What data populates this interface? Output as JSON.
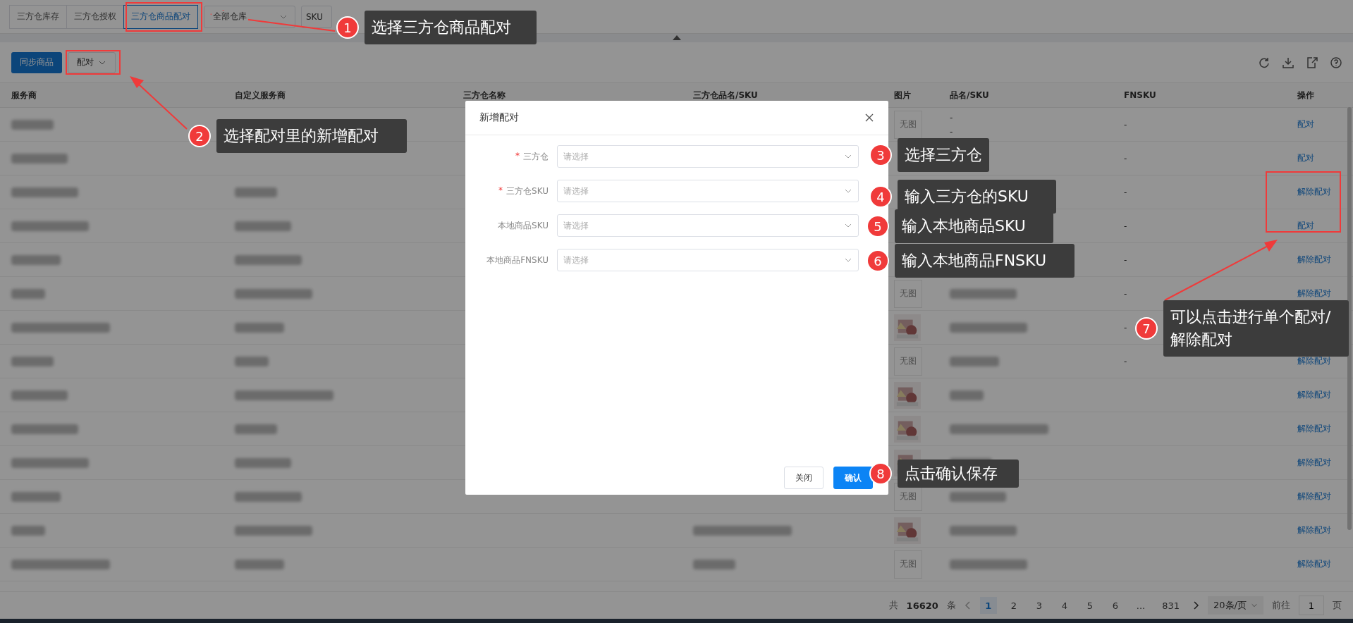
{
  "top_tabs": [
    {
      "label": "三方仓库存",
      "selected": false
    },
    {
      "label": "三方仓授权",
      "selected": false
    },
    {
      "label": "三方仓商品配对",
      "selected": true
    }
  ],
  "filters": {
    "warehouse_select": {
      "value": "全部仓库"
    },
    "search_type": {
      "value": "SKU"
    }
  },
  "toolbar": {
    "buttons": [
      {
        "label": "同步商品",
        "kind": "primary"
      },
      {
        "label": "配对",
        "kind": "dropdown"
      }
    ]
  },
  "table": {
    "columns": [
      "服务商",
      "自定义服务商",
      "三方仓名称",
      "三方仓品名/SKU",
      "图片",
      "品名/SKU",
      "FNSKU",
      "操作"
    ],
    "rows": [
      {
        "image": {
          "kind": "placeholder",
          "text": "无图"
        },
        "product_lines": [
          "-",
          "-"
        ],
        "fnsku": "-",
        "action": "配对"
      },
      {
        "fnsku": "-",
        "action": "配对"
      },
      {
        "fnsku": "-",
        "action": "解除配对"
      },
      {
        "fnsku": "-",
        "action": "配对"
      },
      {
        "fnsku": "-",
        "action": "解除配对"
      },
      {
        "image": {
          "kind": "placeholder",
          "text": "无图"
        },
        "fnsku": "-",
        "action": "解除配对"
      },
      {
        "fnsku": "-"
      },
      {
        "image": {
          "kind": "placeholder",
          "text": "无图"
        },
        "fnsku": "-",
        "action": "解除配对"
      },
      {
        "action": "解除配对"
      },
      {
        "action": "解除配对"
      },
      {
        "action": "解除配对"
      },
      {
        "image": {
          "kind": "placeholder",
          "text": "无图"
        },
        "action": "解除配对"
      },
      {
        "action": "解除配对"
      },
      {
        "image": {
          "kind": "placeholder",
          "text": "无图"
        },
        "action": "解除配对"
      }
    ]
  },
  "pagination": {
    "total_prefix": "共",
    "total": "16620",
    "total_suffix": "条",
    "pages": [
      {
        "label": "1",
        "selected": true
      },
      {
        "label": "2",
        "selected": false
      },
      {
        "label": "3",
        "selected": false
      },
      {
        "label": "4",
        "selected": false
      },
      {
        "label": "5",
        "selected": false
      },
      {
        "label": "6",
        "selected": false
      },
      {
        "label": "...",
        "selected": false
      },
      {
        "label": "831",
        "selected": false
      }
    ],
    "page_size": "20条/页",
    "goto_label": "前往",
    "goto_value": "1",
    "goto_suffix": "页"
  },
  "dialog": {
    "title": "新增配对",
    "fields": [
      {
        "required_mark": "*",
        "label": "三方仓",
        "placeholder": "请选择"
      },
      {
        "required_mark": "*",
        "label": "三方仓SKU",
        "placeholder": "请选择"
      },
      {
        "label": "本地商品SKU",
        "placeholder": "请选择"
      },
      {
        "label": "本地商品FNSKU",
        "placeholder": "请选择"
      }
    ],
    "buttons": [
      {
        "label": "关闭",
        "kind": "default"
      },
      {
        "label": "确认",
        "kind": "primary"
      }
    ]
  },
  "annotations": [
    {
      "number": "1",
      "text": "选择三方仓商品配对"
    },
    {
      "number": "2",
      "text": "选择配对里的新增配对"
    },
    {
      "number": "3",
      "text": "选择三方仓"
    },
    {
      "number": "4",
      "text": "输入三方仓的SKU"
    },
    {
      "number": "5",
      "text": "输入本地商品SKU"
    },
    {
      "number": "6",
      "text": "输入本地商品FNSKU"
    },
    {
      "number": "7",
      "text": "可以点击进行单个配对/解除配对"
    },
    {
      "number": "8",
      "text": "点击确认保存"
    }
  ]
}
